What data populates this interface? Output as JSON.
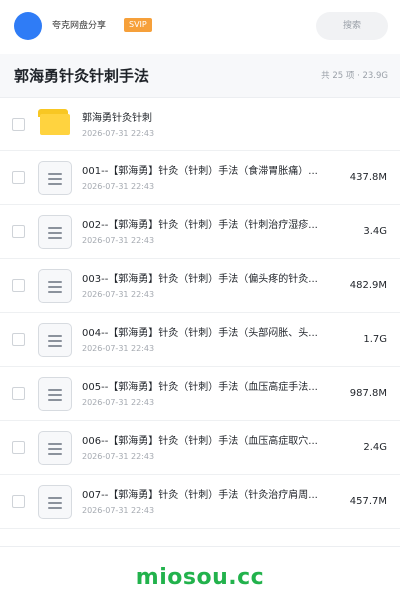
{
  "header": {
    "username": "夸克网盘分享",
    "badge": "SVIP",
    "search_placeholder": "搜索",
    "avatar_color": "#2f7cf6",
    "badge_color": "#f6a03a"
  },
  "folder": {
    "title": "郭海勇针灸针刺手法",
    "summary": "共 25 项 · 23.9G"
  },
  "files": [
    {
      "name": "郭海勇针灸针刺",
      "date": "2026-07-31 22:43",
      "size": "",
      "icon": "folder-icon"
    },
    {
      "name": "001--【郭海勇】针灸（针刺）手法（食滞胃胀痛）...",
      "date": "2026-07-31 22:43",
      "size": "437.8M",
      "icon": "document-icon"
    },
    {
      "name": "002--【郭海勇】针灸（针刺）手法（针刺治疗湿疹...",
      "date": "2026-07-31 22:43",
      "size": "3.4G",
      "icon": "document-icon"
    },
    {
      "name": "003--【郭海勇】针灸（针刺）手法（偏头疼的针灸...",
      "date": "2026-07-31 22:43",
      "size": "482.9M",
      "icon": "document-icon"
    },
    {
      "name": "004--【郭海勇】针灸（针刺）手法（头部闷胀、头...",
      "date": "2026-07-31 22:43",
      "size": "1.7G",
      "icon": "document-icon"
    },
    {
      "name": "005--【郭海勇】针灸（针刺）手法（血压高症手法...",
      "date": "2026-07-31 22:43",
      "size": "987.8M",
      "icon": "document-icon"
    },
    {
      "name": "006--【郭海勇】针灸（针刺）手法（血压高症取穴...",
      "date": "2026-07-31 22:43",
      "size": "2.4G",
      "icon": "document-icon"
    },
    {
      "name": "007--【郭海勇】针灸（针刺）手法（针灸治疗肩周...",
      "date": "2026-07-31 22:43",
      "size": "457.7M",
      "icon": "document-icon"
    }
  ],
  "watermark": {
    "text": "miosou.cc",
    "color": "#22b24c"
  }
}
